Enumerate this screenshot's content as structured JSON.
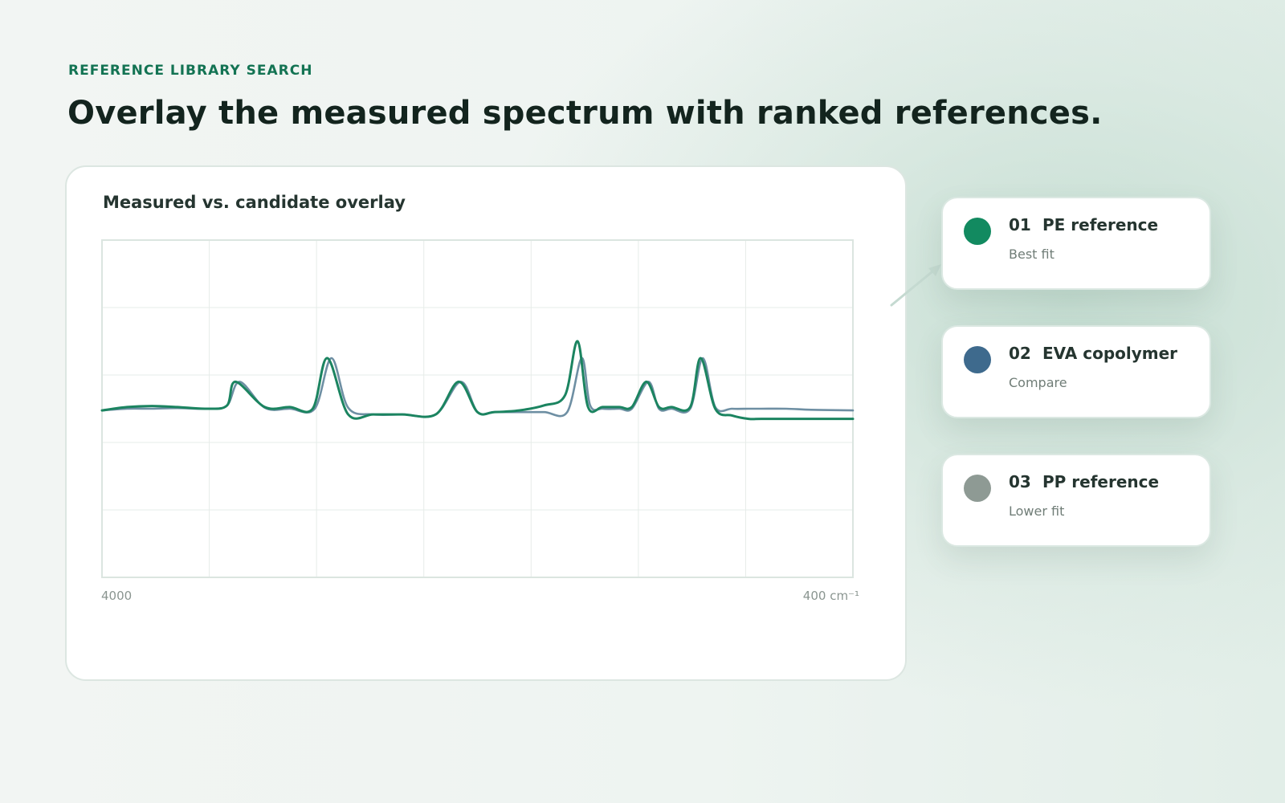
{
  "header": {
    "eyebrow": "REFERENCE LIBRARY SEARCH",
    "title": "Overlay the measured spectrum with ranked references."
  },
  "panel": {
    "title": "Measured vs. candidate overlay"
  },
  "chart_data": {
    "type": "line",
    "title": "Measured vs. candidate overlay",
    "xlabel": "",
    "ylabel": "",
    "x_tick_labels": [
      "4000",
      "400 cm⁻¹"
    ],
    "xlim": [
      4000,
      400
    ],
    "ylim": [
      0,
      1
    ],
    "grid": true,
    "series": [
      {
        "color": "#6e8fa3",
        "x": [
          4000,
          3880,
          3760,
          3640,
          3490,
          3400,
          3340,
          3220,
          3100,
          2980,
          2900,
          2820,
          2700,
          2560,
          2400,
          2280,
          2200,
          2120,
          2000,
          1880,
          1770,
          1700,
          1660,
          1600,
          1520,
          1460,
          1380,
          1330,
          1270,
          1180,
          1120,
          1060,
          980,
          900,
          840,
          720,
          600,
          400
        ],
        "y": [
          0.495,
          0.5,
          0.5,
          0.502,
          0.5,
          0.51,
          0.58,
          0.503,
          0.5,
          0.5,
          0.65,
          0.503,
          0.483,
          0.483,
          0.483,
          0.58,
          0.49,
          0.49,
          0.49,
          0.49,
          0.49,
          0.65,
          0.51,
          0.5,
          0.5,
          0.5,
          0.58,
          0.5,
          0.5,
          0.5,
          0.65,
          0.505,
          0.5,
          0.5,
          0.5,
          0.5,
          0.497,
          0.495
        ]
      },
      {
        "color": "#1b8460",
        "x": [
          4000,
          3880,
          3760,
          3640,
          3490,
          3400,
          3360,
          3220,
          3100,
          2990,
          2920,
          2820,
          2700,
          2560,
          2400,
          2290,
          2200,
          2120,
          2000,
          1880,
          1780,
          1720,
          1670,
          1600,
          1520,
          1460,
          1390,
          1330,
          1270,
          1180,
          1130,
          1060,
          980,
          900,
          840,
          720,
          600,
          400
        ],
        "y": [
          0.495,
          0.505,
          0.508,
          0.505,
          0.5,
          0.51,
          0.58,
          0.505,
          0.505,
          0.5,
          0.65,
          0.483,
          0.483,
          0.483,
          0.483,
          0.58,
          0.49,
          0.49,
          0.495,
          0.51,
          0.54,
          0.7,
          0.505,
          0.505,
          0.505,
          0.505,
          0.58,
          0.505,
          0.505,
          0.505,
          0.65,
          0.5,
          0.48,
          0.47,
          0.47,
          0.47,
          0.47,
          0.47
        ]
      }
    ]
  },
  "results": [
    {
      "rank": "01",
      "name": "PE reference",
      "status": "Best fit",
      "color": "#128a60"
    },
    {
      "rank": "02",
      "name": "EVA copolymer",
      "status": "Compare",
      "color": "#3e6a8d"
    },
    {
      "rank": "03",
      "name": "PP reference",
      "status": "Lower fit",
      "color": "#8e9a94"
    }
  ],
  "connector_color": "#c5dad1"
}
